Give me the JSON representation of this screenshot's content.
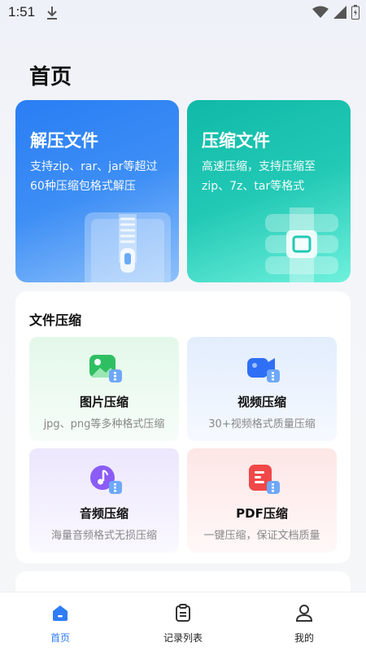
{
  "status": {
    "time": "1:51"
  },
  "page": {
    "title": "首页"
  },
  "hero": [
    {
      "title": "解压文件",
      "desc": "支持zip、rar、jar等超过60种压缩包格式解压"
    },
    {
      "title": "压缩文件",
      "desc": "高速压缩，支持压缩至zip、7z、tar等格式"
    }
  ],
  "compress": {
    "title": "文件压缩",
    "tiles": [
      {
        "name": "图片压缩",
        "desc": "jpg、png等多种格式压缩",
        "icon": "image-icon"
      },
      {
        "name": "视频压缩",
        "desc": "30+视频格式质量压缩",
        "icon": "video-icon"
      },
      {
        "name": "音频压缩",
        "desc": "海量音频格式无损压缩",
        "icon": "music-icon"
      },
      {
        "name": "PDF压缩",
        "desc": "一键压缩，保证文档质量",
        "icon": "document-icon"
      }
    ]
  },
  "nav": [
    {
      "label": "首页",
      "icon": "home-icon",
      "active": true
    },
    {
      "label": "记录列表",
      "icon": "clipboard-icon",
      "active": false
    },
    {
      "label": "我的",
      "icon": "user-icon",
      "active": false
    }
  ],
  "colors": {
    "accent": "#2f7cf6",
    "unzip": "#2a7ef4",
    "zip": "#10b9a8"
  }
}
